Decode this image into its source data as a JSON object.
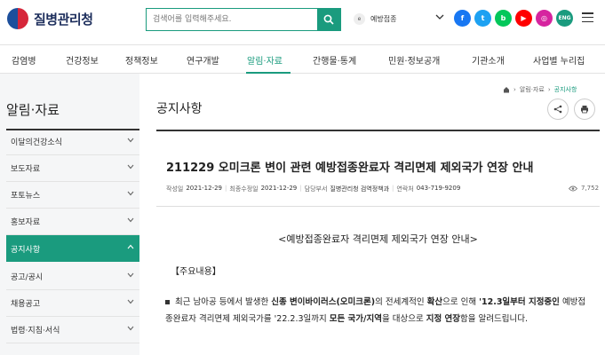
{
  "header": {
    "logo_text": "질병관리청",
    "search_placeholder": "검색어를 입력해주세요.",
    "site_select": "예방접종",
    "site_select_icon": "e",
    "eng_label": "ENG"
  },
  "gnb": [
    "감염병",
    "건강정보",
    "정책정보",
    "연구개발",
    "알림·자료",
    "간행물·통계",
    "민원·정보공개",
    "기관소개",
    "사업별 누리집"
  ],
  "lnb": {
    "title": "알림·자료",
    "items": [
      "이달의건강소식",
      "보도자료",
      "포토뉴스",
      "홍보자료",
      "공지사항",
      "공고/공시",
      "채용공고",
      "법령·지침·서식"
    ],
    "active_index": 4
  },
  "breadcrumb": [
    "알림·자료",
    "공지사항"
  ],
  "page_title": "공지사항",
  "post": {
    "title": "211229 오미크론 변이 관련 예방접종완료자 격리면제 제외국가 연장 안내",
    "meta": {
      "created_label": "작성일",
      "created": "2021-12-29",
      "modified_label": "최종수정일",
      "modified": "2021-12-29",
      "dept_label": "담당부서",
      "dept": "질병관리청 검역정책과",
      "contact_label": "연락처",
      "contact": "043-719-9209"
    },
    "views": "7,752",
    "notice_heading": "<예방접종완료자 격리면제 제외국가 연장 안내>",
    "summary_label": "【주요내용】",
    "body": {
      "p1": "최근 남아공 등에서 발생한 ",
      "b1": "신종 변이바이러스(오미크론)",
      "p2": "의 전세계적인 ",
      "b2": "확산",
      "p3": "으로 인해 ",
      "b3": "'12.3일부터 지정중인",
      "p4": " 예방접종완료자 격리면제 제외국가를 '22.2.3일까지 ",
      "b4": "모든 국가/지역",
      "p5": "을 대상으로 ",
      "b5": "지정 연장",
      "p6": "함을 알려드립니다."
    }
  },
  "colors": {
    "accent": "#1a9b7e",
    "logo_navy": "#1d2e5c"
  }
}
